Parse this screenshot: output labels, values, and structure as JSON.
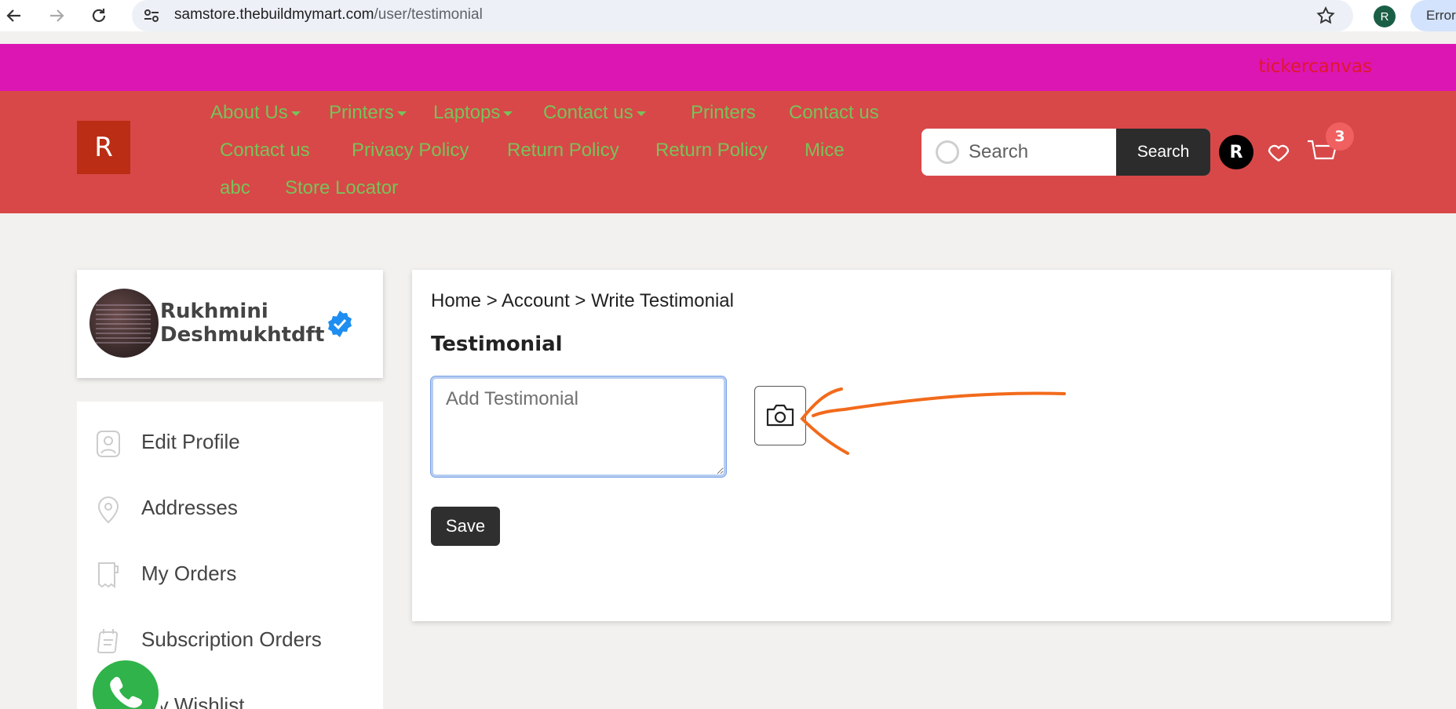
{
  "browser": {
    "url_domain": "samstore.thebuildmymart.com",
    "url_path": "/user/testimonial",
    "profile_initial": "R",
    "error_label": "Error"
  },
  "ticker": {
    "text": "tickercanvas"
  },
  "header": {
    "logo_letter": "R",
    "nav": [
      {
        "label": "About Us",
        "dropdown": true
      },
      {
        "label": "Printers",
        "dropdown": true
      },
      {
        "label": "Laptops",
        "dropdown": true
      },
      {
        "label": "Contact us",
        "dropdown": true
      },
      {
        "label": "Printers",
        "dropdown": false
      },
      {
        "label": "Contact us",
        "dropdown": false
      },
      {
        "label": "Contact us",
        "dropdown": false
      },
      {
        "label": "Privacy Policy",
        "dropdown": false
      },
      {
        "label": "Return Policy",
        "dropdown": false
      },
      {
        "label": "Return Policy",
        "dropdown": false
      },
      {
        "label": "Mice",
        "dropdown": false
      },
      {
        "label": "abc",
        "dropdown": false
      },
      {
        "label": "Store Locator",
        "dropdown": false
      }
    ],
    "search_placeholder": "Search",
    "search_button": "Search",
    "user_initial": "R",
    "cart_count": "3",
    "nav_color": "#78c25a",
    "header_bg": "#d84848"
  },
  "profile": {
    "name_line1": "Rukhmini",
    "name_line2": "Deshmukhtdft",
    "verified_icon": "verified-badge-icon"
  },
  "menu": {
    "items": [
      {
        "label": "Edit Profile",
        "icon": "user-profile-icon"
      },
      {
        "label": "Addresses",
        "icon": "location-pin-icon"
      },
      {
        "label": "My Orders",
        "icon": "receipt-icon"
      },
      {
        "label": "Subscription Orders",
        "icon": "calendar-list-icon"
      },
      {
        "label": "My Wishlist",
        "icon": "heart-icon"
      }
    ]
  },
  "main": {
    "breadcrumb": "Home > Account > Write Testimonial",
    "title": "Testimonial",
    "textarea_placeholder": "Add Testimonial",
    "save_label": "Save"
  }
}
